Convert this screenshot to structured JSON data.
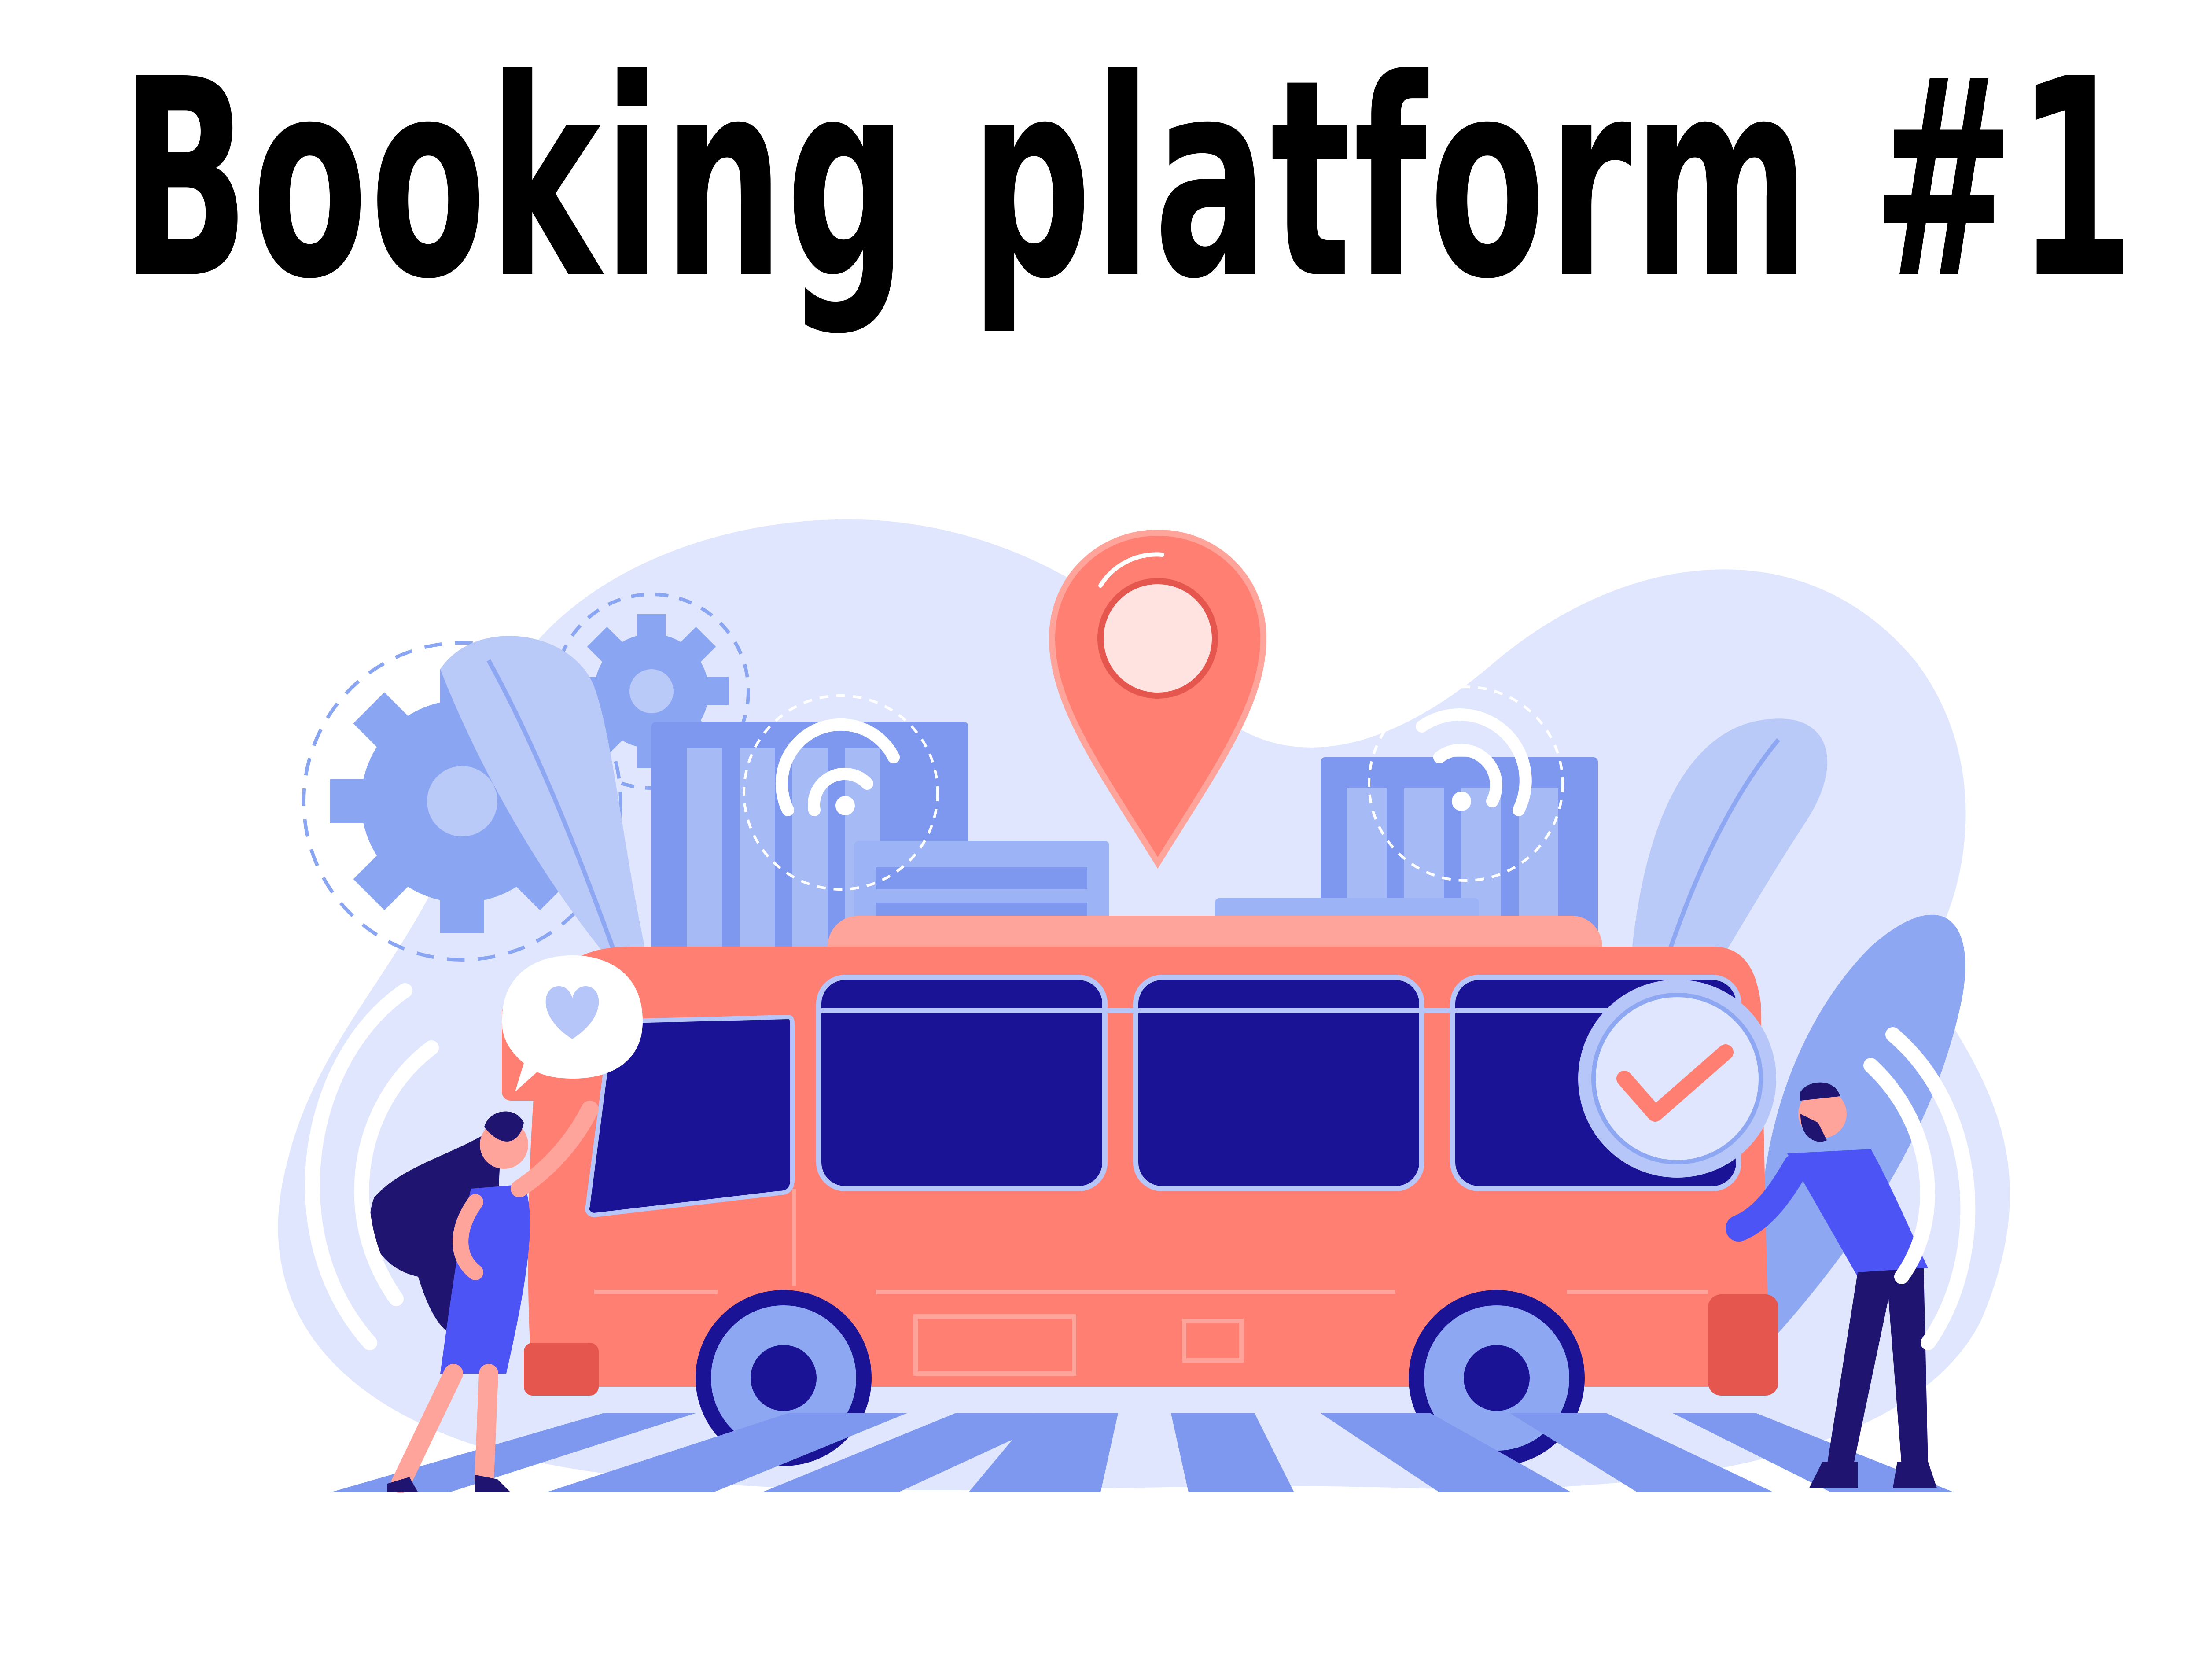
{
  "headline": {
    "text": "Booking platform #1"
  },
  "illustration": {
    "colors": {
      "blob": "#dfe6fd",
      "leaf_light": "#b9c9f8",
      "leaf_mid": "#8da7f2",
      "gear": "#8aa6f2",
      "building": "#7d98ee",
      "bus": "#ff7f72",
      "bus_light": "#ffa49a",
      "bus_dark": "#e5574e",
      "window": "#1b1396",
      "window_frame": "#b7c6f8",
      "wheel_outer": "#1b1396",
      "wheel_inner": "#8da7f2",
      "pin": "#ff7f72",
      "pin_center": "#ffe3e0",
      "check": "#ff7f72",
      "person_dark": "#1f1470",
      "person_blue": "#4d54f5",
      "skin": "#ffa49a",
      "crosswalk": "#7d98ee"
    },
    "icons": [
      "gear-icon",
      "location-pin-icon",
      "wifi-icon",
      "check-icon",
      "heart-icon"
    ]
  }
}
